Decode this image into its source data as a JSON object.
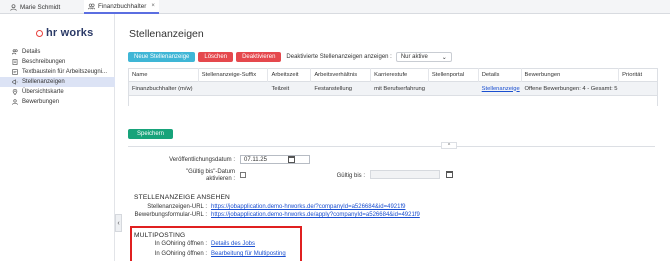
{
  "tabs": [
    {
      "label": "Marie Schmidt"
    },
    {
      "label": "Finanzbuchhalter",
      "close": "×"
    }
  ],
  "logo": {
    "text": "hr works"
  },
  "sidebar": {
    "items": [
      {
        "label": "Details"
      },
      {
        "label": "Beschreibungen"
      },
      {
        "label": "Textbaustein für Arbeitszeugni..."
      },
      {
        "label": "Stellenanzeigen"
      },
      {
        "label": "Übersichtskarte"
      },
      {
        "label": "Bewerbungen"
      }
    ],
    "collapse": "‹"
  },
  "page": {
    "title": "Stellenanzeigen"
  },
  "toolbar": {
    "new_label": "Neue Stellenanzeige",
    "delete_label": "Löschen",
    "deactivate_label": "Deaktivieren",
    "filter_label": "Deaktivierte Stellenanzeigen anzeigen :",
    "filter_value": "Nur aktive",
    "filter_caret": "⌄"
  },
  "table": {
    "headers": [
      "Name",
      "Stellenanzeige-Suffix",
      "Arbeitszeit",
      "Arbeitsverhältnis",
      "Karrierestufe",
      "Stellenportal",
      "Details",
      "Bewerbungen",
      "Priorität"
    ],
    "row": {
      "name": "Finanzbuchhalter (m/w)",
      "suffix": "",
      "arbeitszeit": "Teilzeit",
      "verhaeltnis": "Festanstellung",
      "karriere": "mit Berufserfahrung",
      "portal": "",
      "details": "Stellenanzeige",
      "bewerbungen": "Offene Bewerbungen: 4 - Gesamt: 5",
      "prioritaet": ""
    }
  },
  "save_label": "Speichern",
  "collapse_up": "^",
  "form": {
    "pub_date_label": "Veröffentlichungsdatum :",
    "pub_date_value": "07.11.25",
    "valid_to_label_1": "\"Gültig bis\"-Datum",
    "valid_to_label_2": "aktivieren :",
    "valid_until_label": "Gültig bis :",
    "valid_until_value": ""
  },
  "view_section": {
    "title": "STELLENANZEIGE ANSEHEN",
    "url_label": "Stellenanzeigen-URL :",
    "url_value": "https://jobapplication.demo-hrworks.de/?companyId=a526684&id=4921f9",
    "form_label": "Bewerbungsformular-URL :",
    "form_value": "https://jobapplication.demo-hrworks.de/apply?companyId=a526684&id=4921f9"
  },
  "multiposting": {
    "title": "MULTIPOSTING",
    "row1_label": "In GOhiring öffnen :",
    "row1_link": "Details des Jobs",
    "row2_label": "In GOhiring öffnen :",
    "row2_link": "Bearbeitung für Multiposting"
  },
  "colors": {
    "accent": "#5b6ee1",
    "new_btn": "#3fb6d6",
    "danger": "#e5484d",
    "save": "#17a37a",
    "highlight": "#e02020"
  }
}
